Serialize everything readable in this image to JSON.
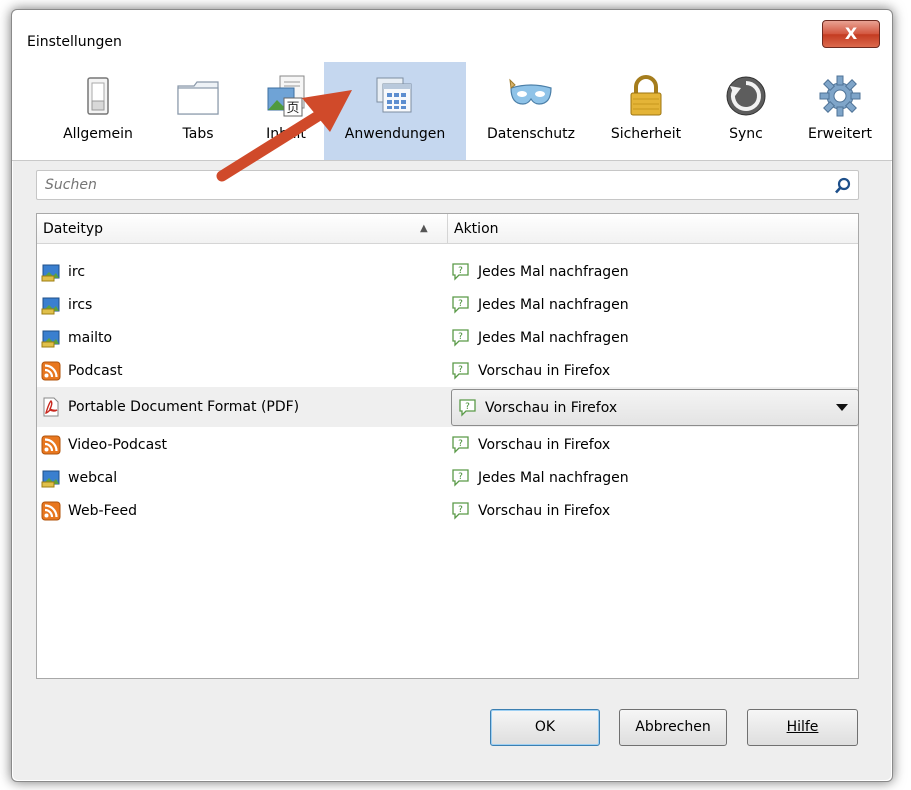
{
  "window": {
    "title": "Einstellungen",
    "close_label": "X"
  },
  "toolbar": {
    "items": [
      {
        "label": "Allgemein",
        "icon": "switch-icon"
      },
      {
        "label": "Tabs",
        "icon": "tabs-icon"
      },
      {
        "label": "Inhalt",
        "icon": "content-icon"
      },
      {
        "label": "Anwendungen",
        "icon": "applications-icon",
        "selected": true
      },
      {
        "label": "Datenschutz",
        "icon": "mask-icon"
      },
      {
        "label": "Sicherheit",
        "icon": "lock-icon"
      },
      {
        "label": "Sync",
        "icon": "sync-icon"
      },
      {
        "label": "Erweitert",
        "icon": "gear-icon"
      }
    ],
    "selected_bg": "#c5d7ef"
  },
  "search": {
    "placeholder": "Suchen"
  },
  "table": {
    "columns": [
      "Dateityp",
      "Aktion"
    ],
    "sort_indicator": "▲",
    "rows": [
      {
        "type": "irc",
        "type_icon": "application-icon",
        "action": "Jedes Mal nachfragen"
      },
      {
        "type": "ircs",
        "type_icon": "application-icon",
        "action": "Jedes Mal nachfragen"
      },
      {
        "type": "mailto",
        "type_icon": "application-icon",
        "action": "Jedes Mal nachfragen"
      },
      {
        "type": "Podcast",
        "type_icon": "rss-icon",
        "action": "Vorschau in Firefox"
      },
      {
        "type": "Portable Document Format (PDF)",
        "type_icon": "pdf-icon",
        "action": "Vorschau in Firefox",
        "selected": true
      },
      {
        "type": "Video-Podcast",
        "type_icon": "rss-icon",
        "action": "Vorschau in Firefox"
      },
      {
        "type": "webcal",
        "type_icon": "application-icon",
        "action": "Jedes Mal nachfragen"
      },
      {
        "type": "Web-Feed",
        "type_icon": "rss-icon",
        "action": "Vorschau in Firefox"
      }
    ]
  },
  "buttons": {
    "ok": "OK",
    "cancel": "Abbrechen",
    "help": "Hilfe"
  },
  "annotation": {
    "arrow_color": "#d04a2a"
  }
}
